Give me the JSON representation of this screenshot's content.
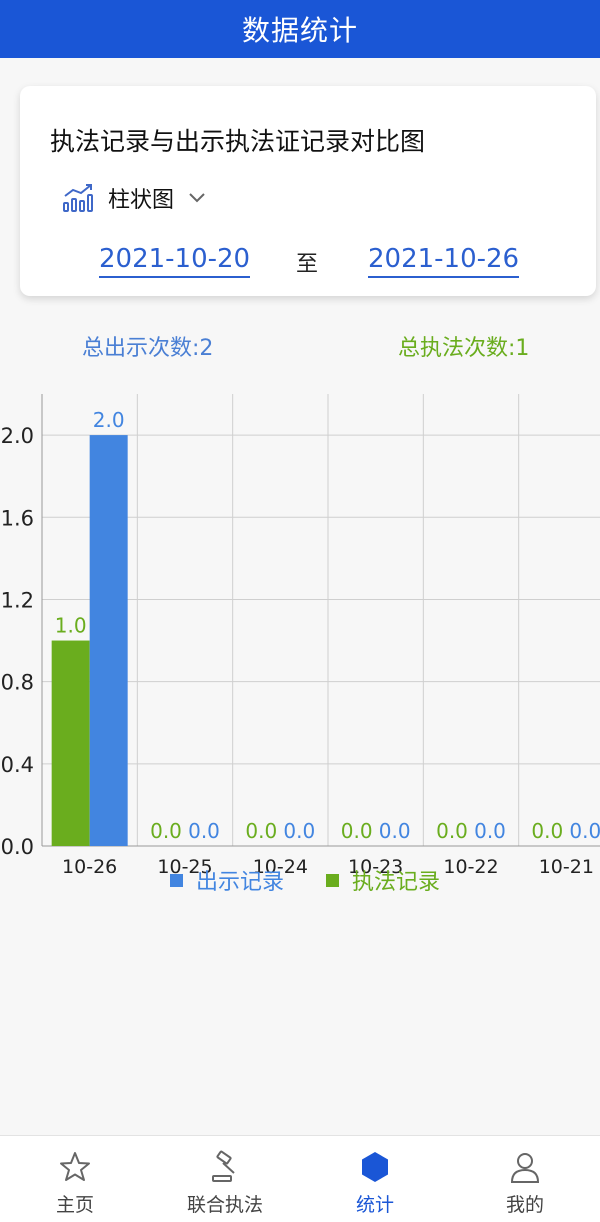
{
  "header": {
    "title": "数据统计"
  },
  "card": {
    "title": "执法记录与出示执法证记录对比图",
    "chart_type_label": "柱状图",
    "start_date": "2021-10-20",
    "to_label": "至",
    "end_date": "2021-10-26"
  },
  "stats": {
    "total_show": "总出示次数:2",
    "total_enforce": "总执法次数:1"
  },
  "colors": {
    "header": "#1a56d6",
    "show_series": "#4285e0",
    "enforce_series": "#6aad1e",
    "show_text": "#4a7fd4",
    "enforce_text": "#6aad1e"
  },
  "chart_data": {
    "type": "bar",
    "categories": [
      "10-26",
      "10-25",
      "10-24",
      "10-23",
      "10-22",
      "10-21"
    ],
    "series": [
      {
        "name": "执法记录",
        "values": [
          1.0,
          0.0,
          0.0,
          0.0,
          0.0,
          0.0
        ],
        "color": "#6aad1e"
      },
      {
        "name": "出示记录",
        "values": [
          2.0,
          0.0,
          0.0,
          0.0,
          0.0,
          0.0
        ],
        "color": "#4285e0"
      }
    ],
    "legend": [
      "出示记录",
      "执法记录"
    ],
    "legend_position": "bottom",
    "yticks": [
      "0.0",
      "0.4",
      "0.8",
      "1.2",
      "1.6",
      "2.0"
    ],
    "ylim": [
      0,
      2.2
    ],
    "grid": true
  },
  "tabs": [
    {
      "label": "主页",
      "icon": "star-icon",
      "active": false
    },
    {
      "label": "联合执法",
      "icon": "gavel-icon",
      "active": false
    },
    {
      "label": "统计",
      "icon": "hexagon-icon",
      "active": true
    },
    {
      "label": "我的",
      "icon": "person-icon",
      "active": false
    }
  ]
}
